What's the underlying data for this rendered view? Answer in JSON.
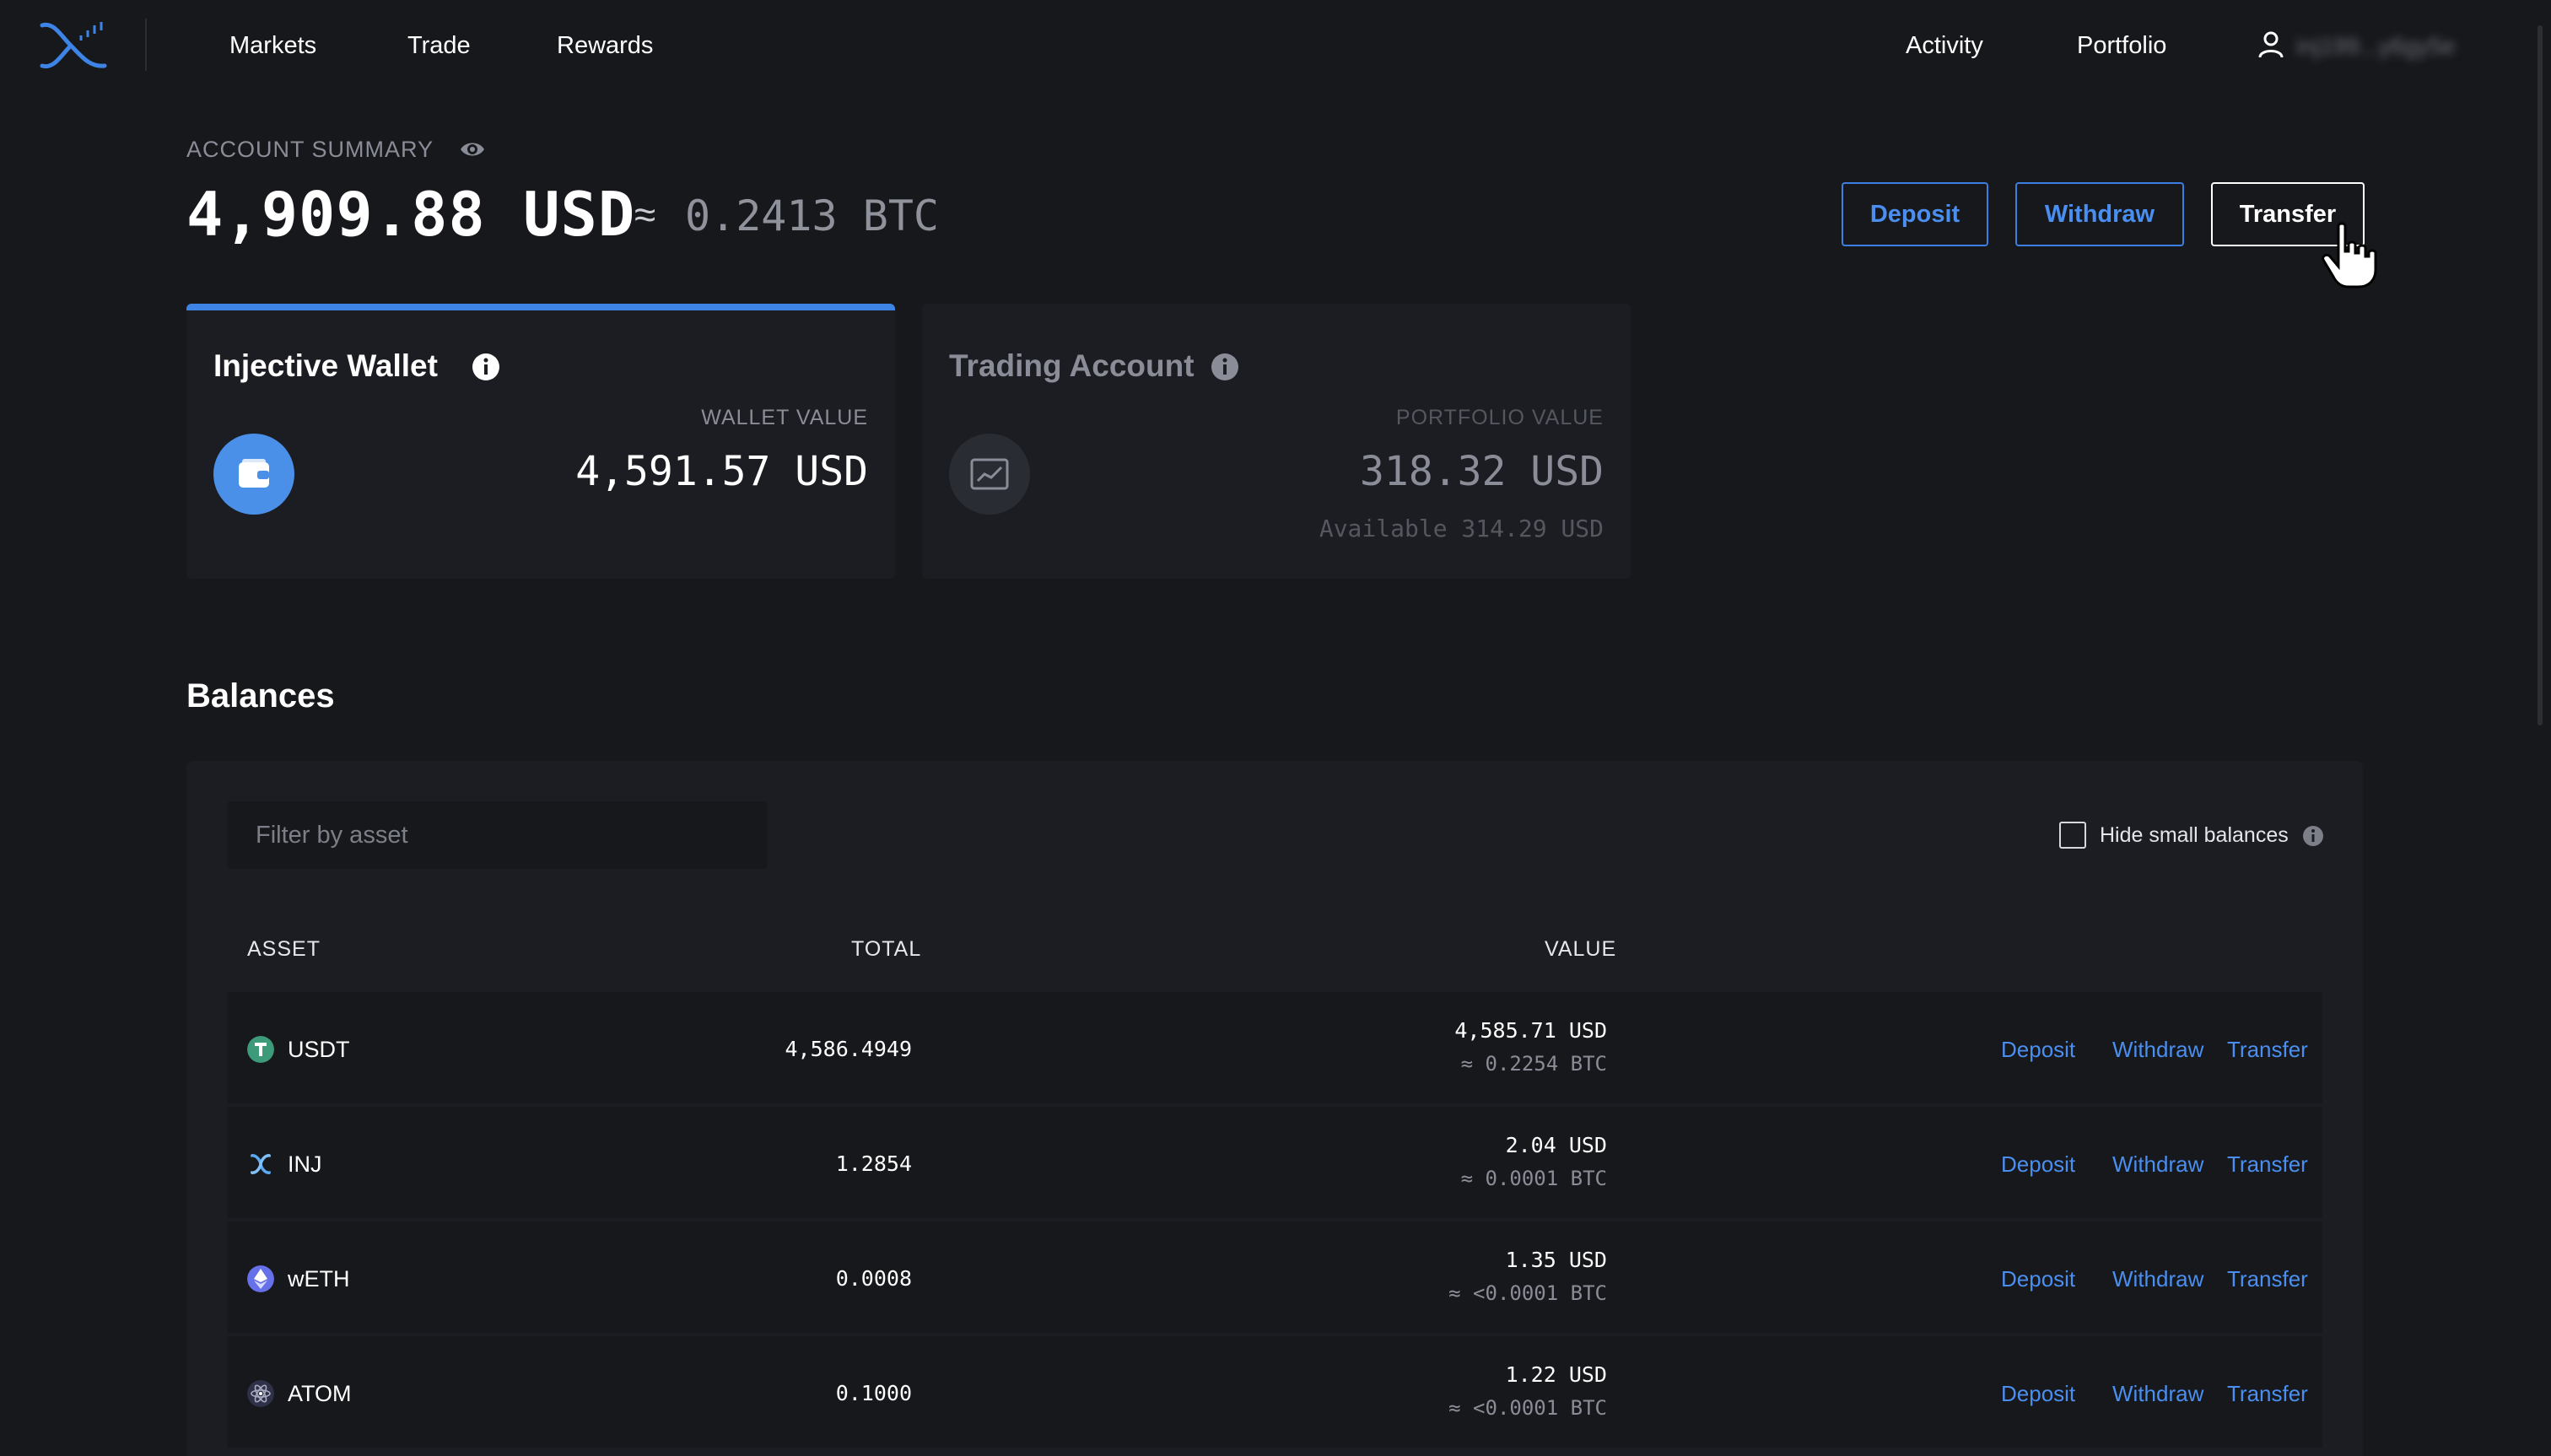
{
  "nav": {
    "left_items": [
      "Markets",
      "Trade",
      "Rewards"
    ],
    "right_items": [
      "Activity",
      "Portfolio"
    ],
    "user_address": "inj199...y6gy5e",
    "logo_icon": "injective-logo-icon",
    "user_icon": "user-icon"
  },
  "summary": {
    "label": "ACCOUNT SUMMARY",
    "total_usd": "4,909.88 USD",
    "approx": "≈",
    "total_btc": "0.2413 BTC",
    "buttons": {
      "deposit": "Deposit",
      "withdraw": "Withdraw",
      "transfer": "Transfer"
    }
  },
  "cards": {
    "wallet": {
      "title": "Injective Wallet",
      "value_label": "WALLET VALUE",
      "value": "4,591.57 USD",
      "icon": "wallet-icon"
    },
    "trading": {
      "title": "Trading Account",
      "value_label": "PORTFOLIO VALUE",
      "value": "318.32 USD",
      "available": "Available 314.29 USD",
      "icon": "chart-icon"
    }
  },
  "balances": {
    "title": "Balances",
    "filter_placeholder": "Filter by asset",
    "hide_small_label": "Hide small balances",
    "hide_small_checked": false,
    "headers": {
      "asset": "ASSET",
      "total": "TOTAL",
      "value": "VALUE"
    },
    "actions": {
      "deposit": "Deposit",
      "withdraw": "Withdraw",
      "transfer": "Transfer"
    },
    "rows": [
      {
        "asset": "USDT",
        "total": "4,586.4949",
        "value_usd": "4,585.71 USD",
        "value_btc": "≈ 0.2254 BTC",
        "icon_color": "#3d9b7a"
      },
      {
        "asset": "INJ",
        "total": "1.2854",
        "value_usd": "2.04 USD",
        "value_btc": "≈ 0.0001 BTC",
        "icon_color": "#5aa9f0"
      },
      {
        "asset": "wETH",
        "total": "0.0008",
        "value_usd": "1.35 USD",
        "value_btc": "≈ <0.0001 BTC",
        "icon_color": "#6670e8"
      },
      {
        "asset": "ATOM",
        "total": "0.1000",
        "value_usd": "1.22 USD",
        "value_btc": "≈ <0.0001 BTC",
        "icon_color": "#2e3148"
      }
    ]
  },
  "colors": {
    "background": "#17181c",
    "card": "#1c1d22",
    "accent": "#3e83e6",
    "link": "#4a8ff0"
  }
}
